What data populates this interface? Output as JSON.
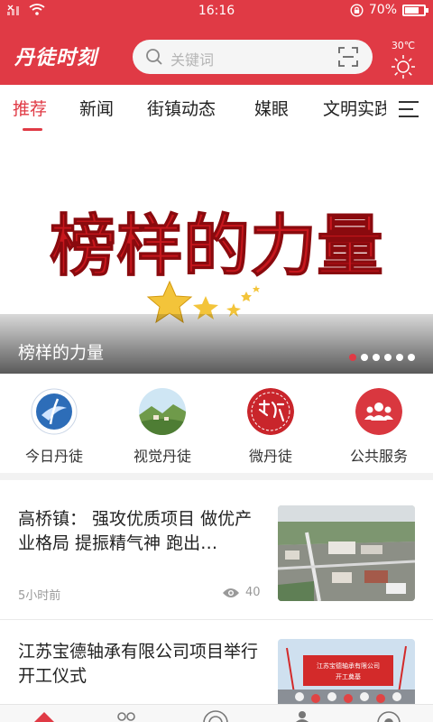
{
  "status_bar": {
    "time": "16:16",
    "battery": "70%",
    "battery_level": 0.7
  },
  "header": {
    "logo": "丹徒时刻",
    "search_placeholder": "关键词",
    "weather_temp": "30℃"
  },
  "tabs": [
    {
      "label": "推荐",
      "active": true
    },
    {
      "label": "新闻",
      "active": false
    },
    {
      "label": "街镇动态",
      "active": false
    },
    {
      "label": "媒眼",
      "active": false
    },
    {
      "label": "文明实践",
      "active": false
    }
  ],
  "banner": {
    "art_text": "榜样的力量",
    "caption": "榜样的力量",
    "dot_count": 6,
    "active_dot": 0
  },
  "quick_links": [
    {
      "label": "今日丹徒",
      "icon": "jinri-logo-icon"
    },
    {
      "label": "视觉丹徒",
      "icon": "landscape-photo-icon"
    },
    {
      "label": "微丹徒",
      "icon": "wei-dantu-seal-icon"
    },
    {
      "label": "公共服务",
      "icon": "people-group-icon"
    }
  ],
  "news": [
    {
      "title": "高桥镇： 强攻优质项目 做优产业格局 提振精气神 跑出…",
      "time": "5小时前",
      "views": "40"
    },
    {
      "title": "江苏宝德轴承有限公司项目举行开工仪式",
      "thumb_banner": "江苏宝德轴承有限公司\n开工奠基"
    }
  ],
  "colors": {
    "accent": "#e03a45"
  }
}
